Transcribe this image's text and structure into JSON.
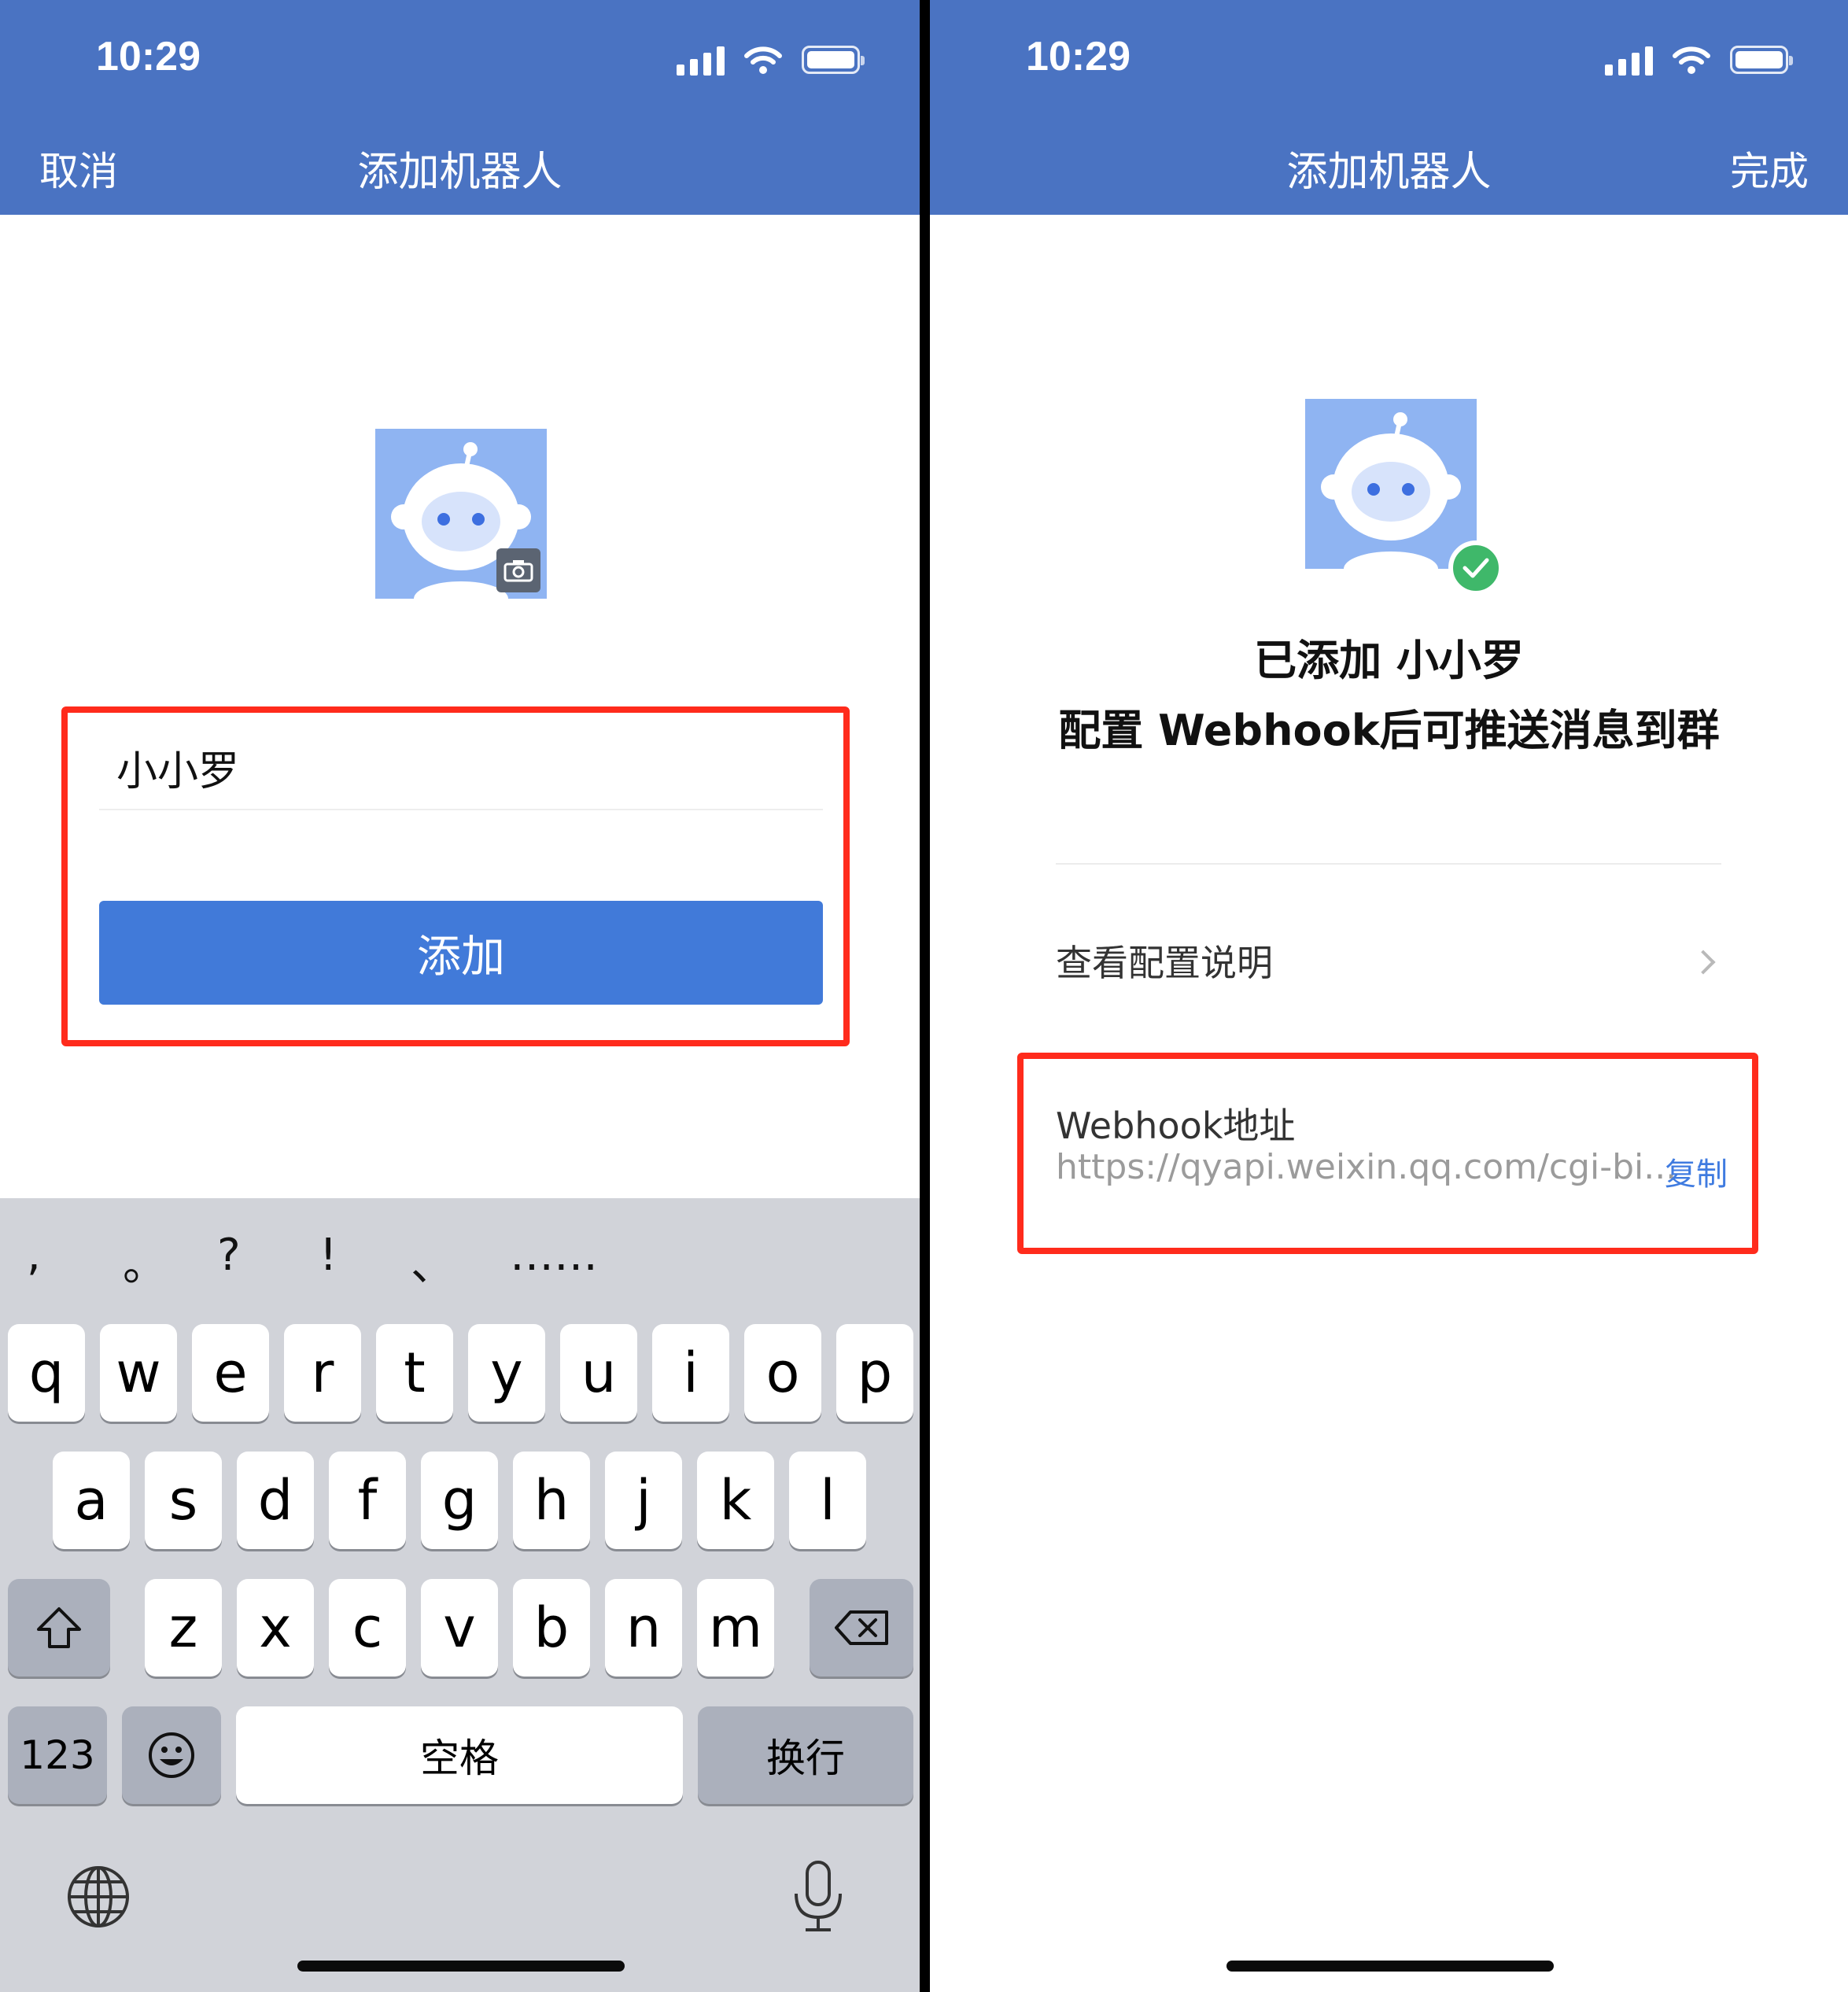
{
  "left_screen": {
    "status": {
      "time": "10:29"
    },
    "nav": {
      "left_action": "取消",
      "title": "添加机器人"
    },
    "form": {
      "name_value": "小小罗",
      "add_button": "添加"
    },
    "keyboard": {
      "punctuation": [
        ",",
        "。",
        "?",
        "!",
        "、",
        "……"
      ],
      "row1": [
        "q",
        "w",
        "e",
        "r",
        "t",
        "y",
        "u",
        "i",
        "o",
        "p"
      ],
      "row2": [
        "a",
        "s",
        "d",
        "f",
        "g",
        "h",
        "j",
        "k",
        "l"
      ],
      "row3": [
        "z",
        "x",
        "c",
        "v",
        "b",
        "n",
        "m"
      ],
      "numbers_key": "123",
      "space_key": "空格",
      "return_key": "换行"
    }
  },
  "right_screen": {
    "status": {
      "time": "10:29"
    },
    "nav": {
      "title": "添加机器人",
      "right_action": "完成"
    },
    "result": {
      "headline_line1": "已添加 小小罗",
      "headline_line2": "配置 Webhook后可推送消息到群"
    },
    "config_row": {
      "label": "查看配置说明"
    },
    "webhook": {
      "label": "Webhook地址",
      "url": "https://qyapi.weixin.qq.com/cgi-bi...",
      "copy_label": "复制"
    }
  },
  "colors": {
    "nav_bg": "#4a73c2",
    "button_blue": "#417ad9",
    "highlight_red": "#ff2b1c",
    "success_green": "#3fb86a",
    "link_blue": "#3f7be0",
    "keyboard_bg": "#d1d3d9"
  },
  "icons": [
    "signal-icon",
    "wifi-icon",
    "battery-icon",
    "camera-icon",
    "check-icon",
    "chevron-right-icon",
    "shift-icon",
    "backspace-icon",
    "emoji-icon",
    "globe-icon",
    "microphone-icon"
  ]
}
